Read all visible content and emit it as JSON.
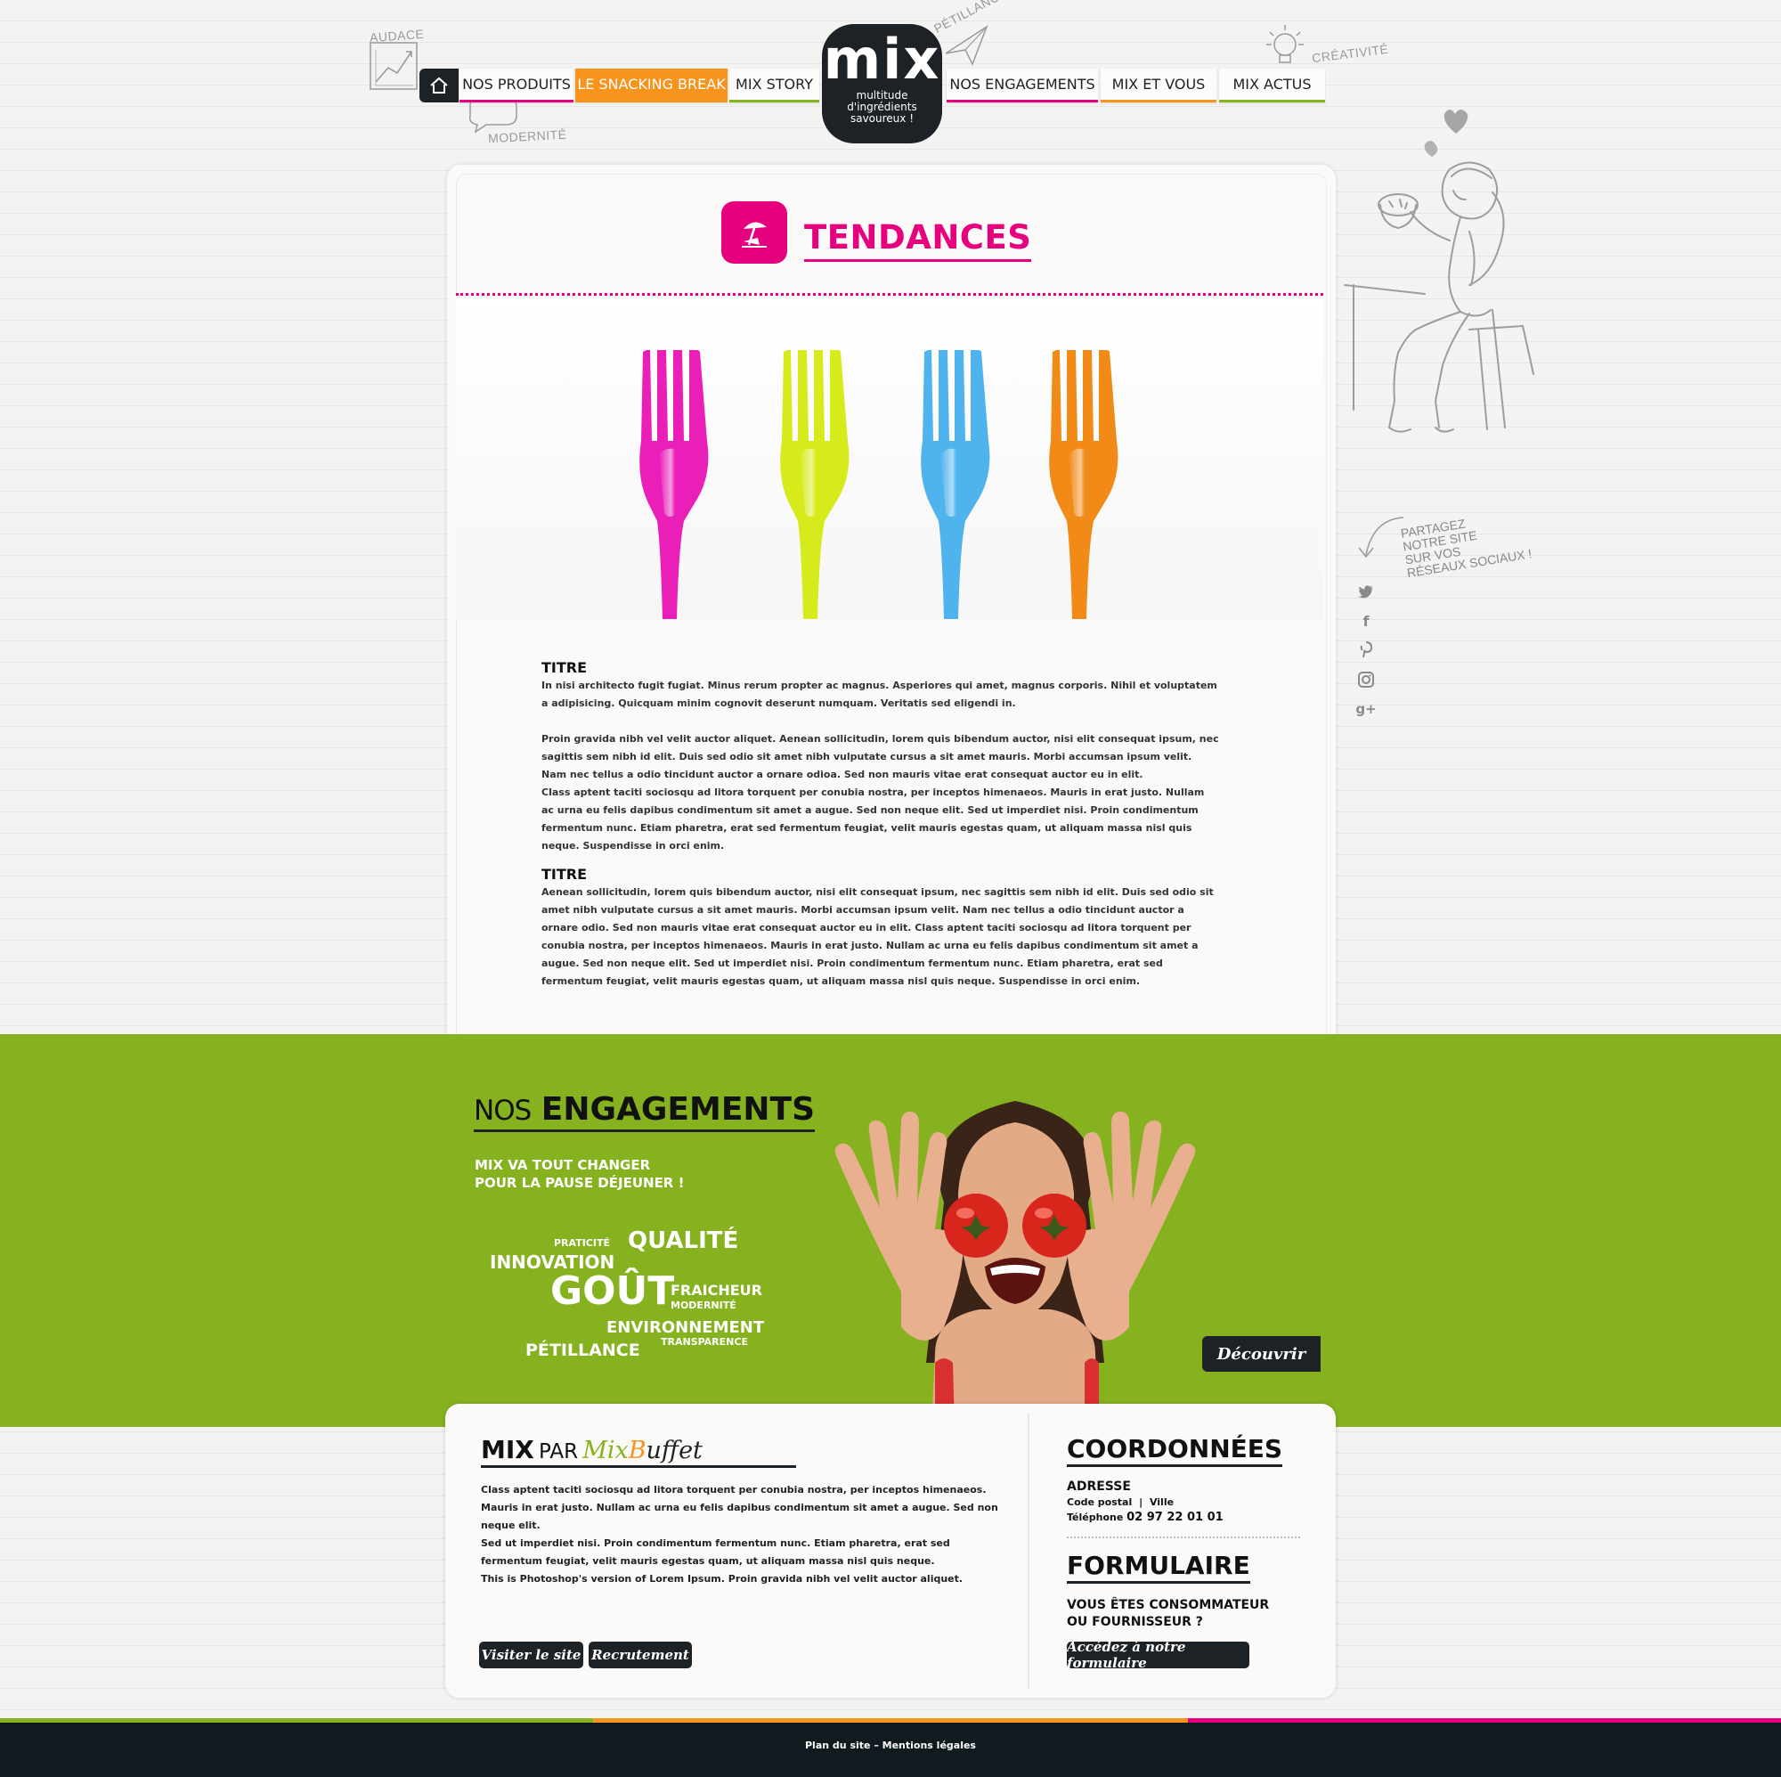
{
  "doodles": {
    "audace": "AUDACE",
    "petillance": "PÉTILLANCE",
    "creativite": "CRÉATIVITÉ",
    "modernite": "MODERNITÉ"
  },
  "nav": {
    "home_icon": "home-icon",
    "left": [
      "NOS PRODUITS",
      "LE SNACKING BREAK",
      "MIX STORY"
    ],
    "right": [
      "NOS ENGAGEMENTS",
      "MIX ET VOUS",
      "MIX ACTUS"
    ],
    "active_index": 1,
    "underline_colors": [
      "#e6007e",
      "#f7941d",
      "#86b21f",
      "#e6007e",
      "#f7941d",
      "#86b21f"
    ]
  },
  "logo": {
    "word": "mix",
    "tagline": [
      "multitude",
      "d'ingrédients",
      "savoureux !"
    ]
  },
  "page": {
    "title": "TENDANCES",
    "icon": "beach-umbrella-icon"
  },
  "hero": {
    "forks": [
      "#e91fb8",
      "#d7ea1c",
      "#4fb3ee",
      "#f28a18"
    ]
  },
  "article": {
    "sections": [
      {
        "title": "TITRE",
        "paragraphs": [
          "In nisi architecto fugit fugiat. Minus rerum propter ac magnus. Asperiores qui amet, magnus corporis. Nihil et voluptatem a adipisicing. Quicquam minim cognovit deserunt numquam. Veritatis sed eligendi in.",
          "Proin gravida nibh vel velit auctor aliquet. Aenean sollicitudin, lorem quis bibendum auctor, nisi elit consequat ipsum, nec sagittis sem nibh id elit. Duis sed odio sit amet nibh vulputate cursus a sit amet mauris. Morbi accumsan ipsum velit. Nam nec tellus a odio tincidunt auctor a ornare odioa. Sed non  mauris vitae erat consequat auctor eu in elit.",
          "Class aptent taciti sociosqu ad litora torquent per conubia nostra, per inceptos himenaeos. Mauris in erat justo. Nullam ac urna eu felis dapibus condimentum sit amet a augue. Sed non neque elit. Sed ut imperdiet nisi. Proin condimentum fermentum nunc. Etiam pharetra, erat sed fermentum feugiat, velit mauris egestas quam, ut aliquam massa nisl quis neque. Suspendisse in orci enim."
        ]
      },
      {
        "title": "TITRE",
        "paragraphs": [
          "Aenean sollicitudin, lorem quis bibendum auctor, nisi elit consequat ipsum, nec sagittis sem nibh id elit. Duis sed odio sit amet nibh vulputate cursus a sit amet mauris. Morbi accumsan ipsum velit. Nam nec tellus a odio tincidunt auctor a ornare odio. Sed non  mauris vitae erat consequat auctor eu in elit. Class aptent taciti sociosqu ad litora torquent per conubia nostra, per inceptos himenaeos. Mauris in erat justo. Nullam ac urna eu felis dapibus condimentum sit amet a augue. Sed non neque elit. Sed ut imperdiet nisi. Proin condimentum fermentum nunc. Etiam pharetra, erat sed fermentum feugiat, velit mauris egestas quam, ut aliquam massa nisl quis neque. Suspendisse in orci enim."
        ]
      }
    ]
  },
  "share": {
    "text": [
      "PARTAGEZ",
      "NOTRE SITE",
      "SUR VOS",
      "RÉSEAUX SOCIAUX !"
    ],
    "icons": [
      "twitter-icon",
      "facebook-icon",
      "pinterest-icon",
      "instagram-icon",
      "google-plus-icon"
    ]
  },
  "engagements": {
    "title_light": "NOS",
    "title_bold": "ENGAGEMENTS",
    "subtitle_line1": "MIX VA TOUT CHANGER",
    "subtitle_line2": "POUR LA PAUSE DÉJEUNER !",
    "words": {
      "praticite": "PRATICITÉ",
      "qualite": "QUALITÉ",
      "innovation": "INNOVATION",
      "gout": "GOÛT",
      "fraicheur": "FRAICHEUR",
      "modernite": "MODERNITÉ",
      "environnement": "ENVIRONNEMENT",
      "petillance": "PÉTILLANCE",
      "transparence": "TRANSPARENCE"
    },
    "cta": "Découvrir",
    "background": "#86b21f"
  },
  "about": {
    "mix": "MIX",
    "par": "PAR",
    "brand_a": "Mix",
    "brand_b": "B",
    "brand_c": "uffet",
    "lines": [
      "Class aptent taciti sociosqu ad litora torquent per conubia nostra, per inceptos himenaeos. Mauris in erat justo. Nullam ac urna eu felis dapibus condimentum sit amet a augue. Sed non neque elit.",
      "Sed ut imperdiet nisi. Proin condimentum fermentum nunc. Etiam pharetra, erat sed fermentum feugiat, velit mauris egestas quam, ut aliquam massa nisl quis neque.",
      "This is Photoshop's version  of Lorem Ipsum. Proin gravida nibh vel velit auctor aliquet."
    ],
    "buttons": [
      "Visiter le site",
      "Recrutement"
    ]
  },
  "contact": {
    "title": "COORDONNÉES",
    "address_label": "ADRESSE",
    "postal": "Code postal",
    "city": "Ville",
    "phone_label": "Téléphone",
    "phone": "02 97 22 01 01",
    "form_title": "FORMULAIRE",
    "form_q1": "VOUS ÊTES CONSOMMATEUR",
    "form_q2": "OU FOURNISSEUR ?",
    "form_button": "Accédez à notre formulaire"
  },
  "footer": {
    "text": "Plan du site – Mentions légales",
    "stripes": [
      "#86b21f",
      "#f7941d",
      "#e6007e"
    ]
  }
}
